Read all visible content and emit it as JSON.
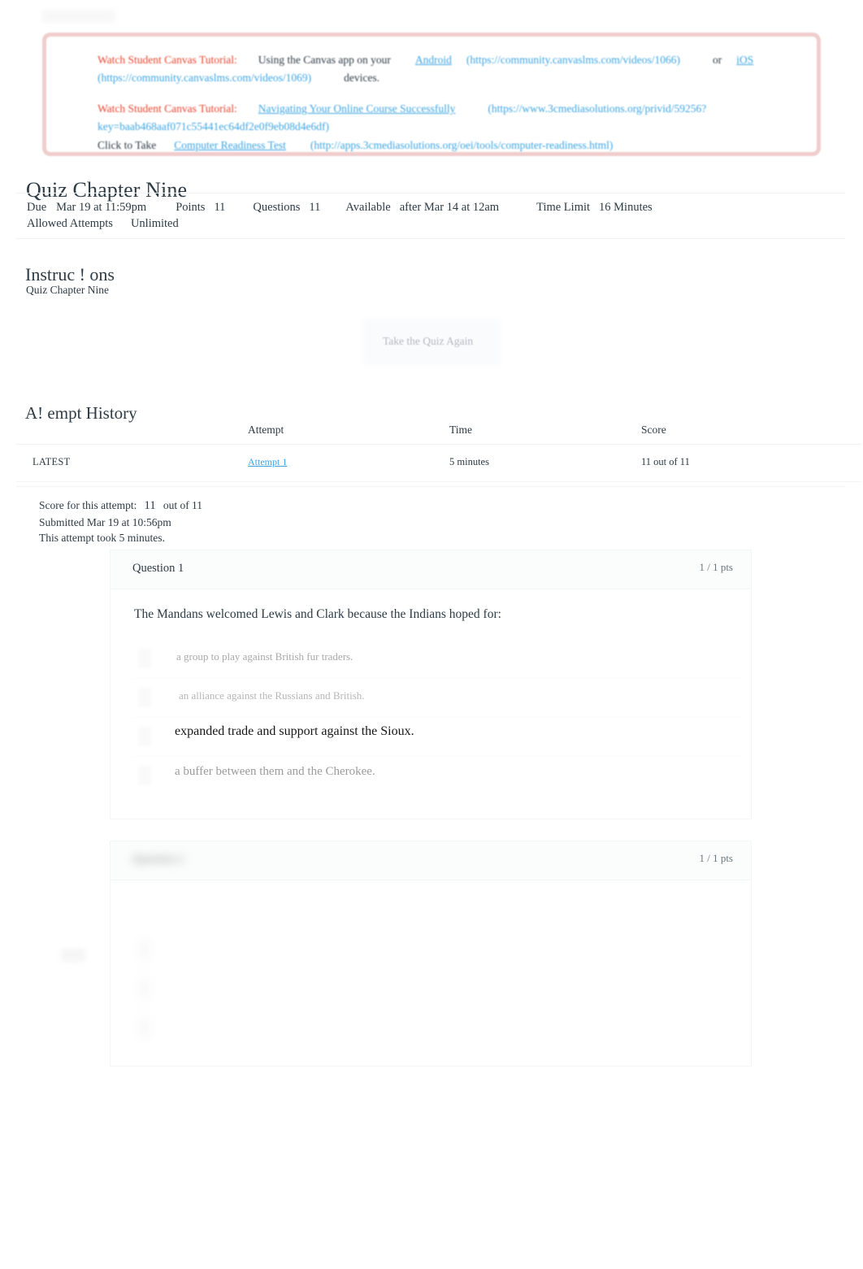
{
  "banner": {
    "line1": {
      "label": "Watch Student Canvas Tutorial:",
      "text_1": "Using the Canvas app on your",
      "link_android": "Android",
      "url_android": "(https://community.canvaslms.com/videos/1066)",
      "conjunction": "or",
      "link_ios": "iOS",
      "url_ios": "(https://community.canvaslms.com/videos/1069)",
      "text_2": "devices."
    },
    "line2": {
      "label": "Watch Student Canvas Tutorial:",
      "link": "Navigating Your Online Course Successfully",
      "url_part1": "(https://www.3cmediasolutions.org/privid/59256?",
      "url_part2": "key=baab468aaf071c55441ec64df2e0f9eb08d4e6df)"
    },
    "line3": {
      "prefix": "Click to Take",
      "link": "Computer Readiness Test",
      "url": "(http://apps.3cmediasolutions.org/oei/tools/computer-readiness.html)"
    },
    "colors": {
      "label": "#e8442e",
      "link": "#3ba4e0",
      "border": "#c94c4c"
    }
  },
  "quiz": {
    "title": "Quiz Chapter Nine",
    "details": {
      "due_label": "Due",
      "due_value": "Mar 19 at 11:59pm",
      "points_label": "Points",
      "points_value": "11",
      "questions_label": "Questions",
      "questions_value": "11",
      "available_label": "Available",
      "available_value": "after Mar 14 at 12am",
      "time_limit_label": "Time Limit",
      "time_limit_value": "16 Minutes",
      "attempts_label": "Allowed Attempts",
      "attempts_value": "Unlimited"
    }
  },
  "instructions": {
    "heading": "Instruc ! ons",
    "body": "Quiz Chapter Nine"
  },
  "actions": {
    "retake_label": "Take the Quiz Again"
  },
  "attempt_history": {
    "heading": "A! empt History",
    "columns": [
      "",
      "Attempt",
      "Time",
      "Score"
    ],
    "rows": [
      {
        "kept": "LATEST",
        "attempt": "Attempt 1",
        "time": "5 minutes",
        "score": "11 out of 11"
      }
    ]
  },
  "score_summary": {
    "score_label": "Score for this attempt:",
    "score_value": "11",
    "score_suffix": "out of 11",
    "submitted": "Submitted Mar 19 at 10:56pm",
    "duration": "This attempt took 5 minutes."
  },
  "questions": [
    {
      "name": "Question 1",
      "points": "1 / 1 pts",
      "text": "The Mandans welcomed Lewis and Clark because the Indians hoped for:",
      "answers": [
        {
          "text": "a group to play against British fur traders.",
          "selected": false
        },
        {
          "text": "an alliance against the Russians and British.",
          "selected": false
        },
        {
          "text": "expanded trade and support against the Sioux.",
          "selected": true
        },
        {
          "text": "a buffer between them and the Cherokee.",
          "selected": false
        }
      ]
    },
    {
      "name": "Question 2",
      "points": "1 / 1 pts",
      "text": "",
      "answers": [
        {
          "text": "",
          "selected": true
        },
        {
          "text": "",
          "selected": false
        },
        {
          "text": "",
          "selected": false
        }
      ]
    }
  ]
}
